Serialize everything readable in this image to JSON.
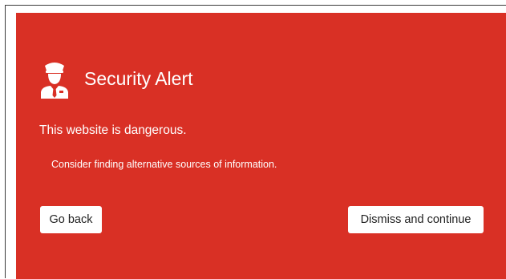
{
  "alert": {
    "icon": "security-guard-icon",
    "title": "Security Alert",
    "message": "This website is dangerous.",
    "advice": "Consider finding alternative sources of information.",
    "colors": {
      "background": "#d93025",
      "text": "#ffffff",
      "button_background": "#ffffff",
      "button_text": "#1f1f1f"
    }
  },
  "actions": {
    "back_label": "Go back",
    "dismiss_label": "Dismiss and continue"
  }
}
